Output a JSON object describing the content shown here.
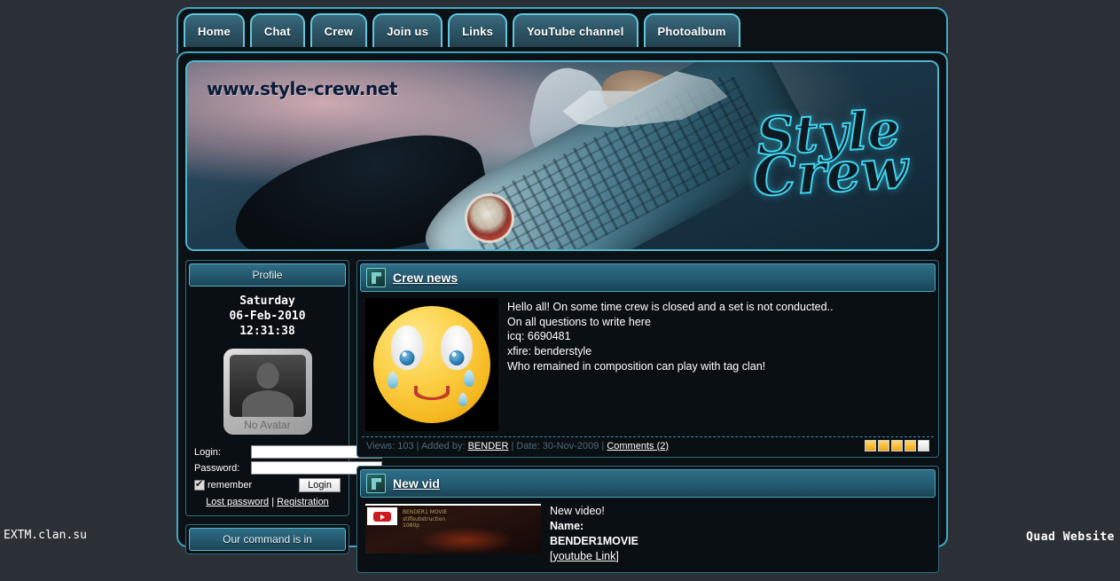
{
  "nav": {
    "items": [
      {
        "label": "Home"
      },
      {
        "label": "Chat"
      },
      {
        "label": "Crew"
      },
      {
        "label": "Join us"
      },
      {
        "label": "Links"
      },
      {
        "label": "YouTube channel"
      },
      {
        "label": "Photoalbum"
      }
    ]
  },
  "banner": {
    "url_text": "www.style-crew.net",
    "logo_line1": "Style",
    "logo_line2": "Crew"
  },
  "sidebar": {
    "profile": {
      "title": "Profile",
      "day": "Saturday",
      "date": "06-Feb-2010",
      "time": "12:31:38",
      "avatar_label": "No Avatar",
      "login_label": "Login:",
      "login_value": "",
      "password_label": "Password:",
      "password_value": "",
      "remember_label": "remember",
      "login_button": "Login",
      "lost_password": "Lost password",
      "separator": "|",
      "registration": "Registration"
    },
    "second_block": {
      "title": "Our command is in"
    }
  },
  "posts": [
    {
      "title": "Crew news",
      "text": "Hello all! On some time crew is closed and a set is not conducted..\nOn all questions to write here\nicq: 6690481\nxfire: benderstyle\nWho remained in composition can play with tag clan!",
      "views_label": "Views: 103 | Added by:",
      "author": "BENDER",
      "date_label": "| Date: 30-Nov-2009 |",
      "comments": "Comments (2)",
      "rating_filled": 4,
      "rating_total": 5
    },
    {
      "title": "New vid",
      "line1": "New video!",
      "line2": "Name:",
      "line3": "BENDER1MOVIE",
      "link_open": "[",
      "link": "youtube Link",
      "link_close": "]",
      "thumb_caption": "BENDER1 MOVIE\nstiflsubstruction\n1080p"
    }
  ],
  "watermarks": {
    "left": "EXTM.clan.su",
    "right": "Quad Website"
  }
}
